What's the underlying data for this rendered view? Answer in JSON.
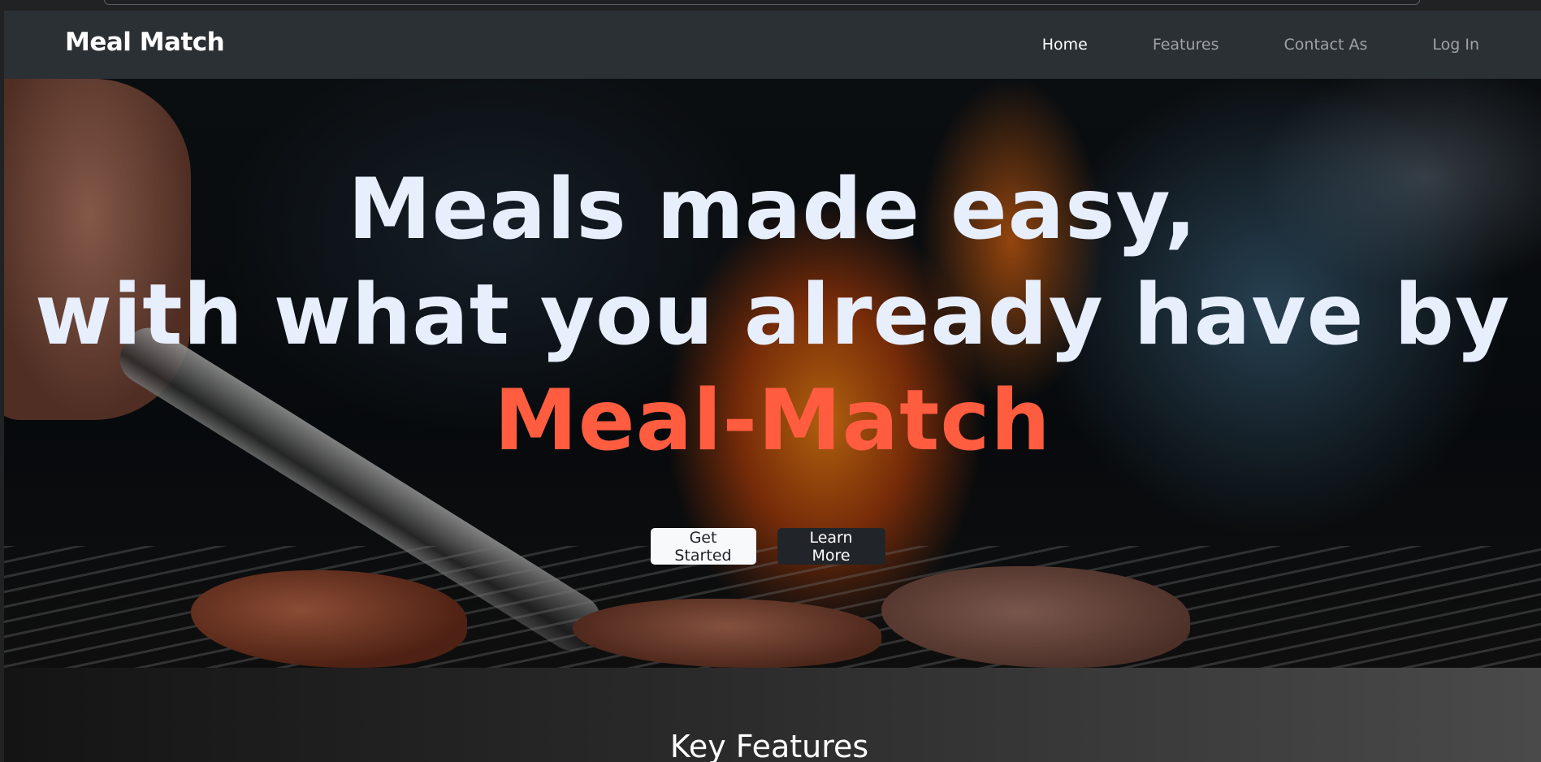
{
  "navbar": {
    "brand": "Meal Match",
    "links": [
      {
        "label": "Home",
        "active": true
      },
      {
        "label": "Features",
        "active": false
      },
      {
        "label": "Contact As",
        "active": false
      },
      {
        "label": "Log In",
        "active": false
      }
    ]
  },
  "hero": {
    "line1": "Meals made easy,",
    "line2": "with what you already have by",
    "line3": "Meal-Match",
    "buttons": {
      "primary": "Get Started",
      "secondary": "Learn More"
    }
  },
  "features": {
    "title": "Key Features"
  },
  "colors": {
    "accent": "#ff5c40",
    "headline": "#e7eefc",
    "navbar": "#2b3035"
  }
}
